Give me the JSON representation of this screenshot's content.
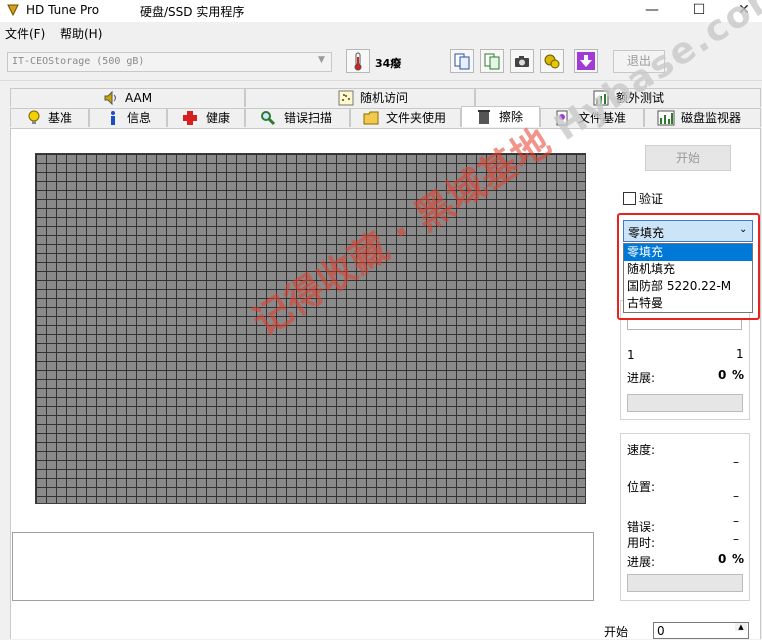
{
  "window": {
    "title": "HD Tune Pro",
    "subtitle": "硬盘/SSD 实用程序",
    "minimize_glyph": "—",
    "maximize_glyph": "☐",
    "close_glyph": "✕"
  },
  "menu": {
    "file": "文件(F)",
    "help": "帮助(H)"
  },
  "toolbar": {
    "drive": "IT-CEOStorage (500 gB)",
    "temperature": "34癈",
    "exit_label": "退出"
  },
  "tabs_top": [
    {
      "label": "AAM",
      "icon": "speaker-icon"
    },
    {
      "label": "随机访问",
      "icon": "scatter-icon"
    },
    {
      "label": "额外测试",
      "icon": "chart-icon"
    }
  ],
  "tabs_bottom": [
    {
      "label": "基准",
      "icon": "lightbulb-icon"
    },
    {
      "label": "信息",
      "icon": "info-icon"
    },
    {
      "label": "健康",
      "icon": "red-cross-icon"
    },
    {
      "label": "错误扫描",
      "icon": "magnifier-icon"
    },
    {
      "label": "文件夹使用",
      "icon": "folder-icon"
    },
    {
      "label": "擦除",
      "icon": "trash-icon"
    },
    {
      "label": "文件基准",
      "icon": "file-icon"
    },
    {
      "label": "磁盘监视器",
      "icon": "monitor-icon"
    }
  ],
  "erase": {
    "start_label": "开始",
    "verify_label": "验证",
    "method_selected": "零填充",
    "method_options": [
      "零填充",
      "随机填充",
      "国防部 5220.22-M",
      "古特曼"
    ],
    "range_left": "1",
    "range_right": "1",
    "progress_label": "进展:",
    "progress_value": "0",
    "percent": "%",
    "speed_label": "速度:",
    "speed_value": "–",
    "position_label": "位置:",
    "position_value": "–",
    "errors_label": "错误:",
    "errors_value": "–",
    "time_label": "用时:",
    "time_value": "–",
    "progress2_label": "进展:",
    "progress2_value": "0",
    "start_field_label": "开始",
    "start_field_value": "0"
  },
  "watermark": {
    "red_text": "记得收藏 · 黑域基地",
    "grey_text": "Hybase.com"
  },
  "colors": {
    "accent": "#0078d7",
    "highlight": "#e8231d",
    "grid_block": "#8a8a8a"
  }
}
